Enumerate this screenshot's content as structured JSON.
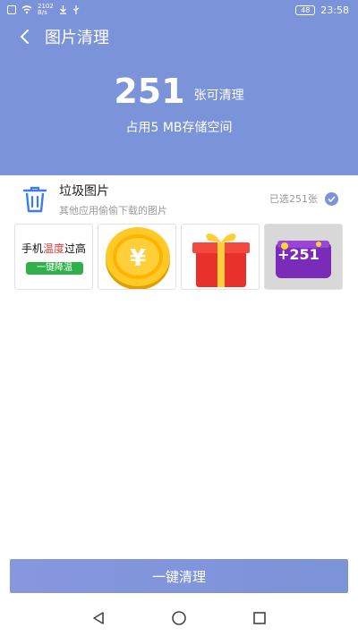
{
  "status_bar": {
    "speed": "2102\nB/s",
    "battery": "48",
    "time": "23:58"
  },
  "header": {
    "title": "图片清理",
    "back_icon": "back-arrow-icon"
  },
  "summary": {
    "count": "251",
    "count_unit": "张可清理",
    "size_text": "占用5 MB存储空间"
  },
  "group": {
    "title": "垃圾图片",
    "subtitle": "其他应用偷偷下载的图片",
    "selected_text": "已选251张",
    "icon": "trash-icon"
  },
  "thumbnails": [
    {
      "kind": "ad-text",
      "line_a": "手机",
      "line_hot": "温度",
      "line_b": "过高",
      "button": "一键降温"
    },
    {
      "kind": "coin",
      "symbol": "¥"
    },
    {
      "kind": "gift"
    },
    {
      "kind": "coin-bag",
      "label": "+251"
    }
  ],
  "actions": {
    "clean_label": "一键清理"
  },
  "colors": {
    "header_bg": "#7b93d8",
    "accent": "#7b93d8",
    "button_bg": "#7b93d8"
  }
}
